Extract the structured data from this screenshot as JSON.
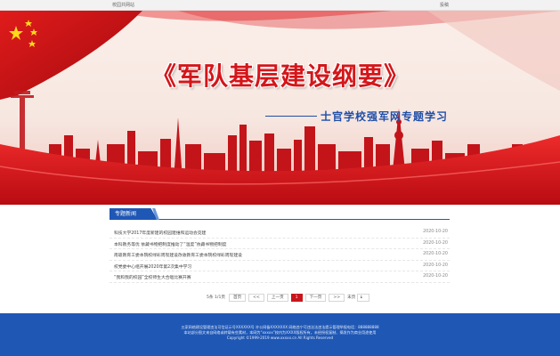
{
  "topbar": {
    "home": "校园共网站",
    "submit": "投稿"
  },
  "banner": {
    "title": "《军队基层建设纲要》",
    "subtitle": "士官学校强军网专题学习"
  },
  "section": {
    "tab_label": "专题新闻"
  },
  "news": [
    {
      "title": "科技大学2017年度新建的校园建维和运动会竞建",
      "date": "2020-10-20"
    },
    {
      "title": "本科教务等优 依藏书物把制度推动了“温度”依藏书物把制度",
      "date": "2020-10-20"
    },
    {
      "title": "南吸教育工委本院校绿彩周现建设改收教育工委本院校绿彩周现建设",
      "date": "2020-10-20"
    },
    {
      "title": "校党委中心组开展2020年第2次集中学习",
      "date": "2020-10-20"
    },
    {
      "title": "“我和我的校园”全校师生大合唱比赛开赛",
      "date": "2020-10-20"
    }
  ],
  "pager": {
    "info": "5条 1/1页",
    "first": "首页",
    "prev_group": "<<",
    "prev": "上一页",
    "current": "1",
    "next": "下一页",
    "next_group": ">>",
    "last": "末页",
    "jump_value": "1"
  },
  "footer": {
    "line1": "五家网络建设管理违法可信证示号XXXXXX号  许公网备XXXXXXX 网络违宁可违法法违法提示管理举报电话：888888888",
    "line2": "本站部分图文来自网络或转载有些素材，本网为“xxxxx”校内为XXXX版权所有，未经授权复制、摘发作为商业用途使用",
    "line3": "Copyright ©1999-2019 www.xxxxx.cn All Rights Reserved"
  },
  "colors": {
    "brand_blue": "#1f57b5",
    "brand_red": "#c8161d"
  },
  "icons": [
    "flag-icon"
  ]
}
